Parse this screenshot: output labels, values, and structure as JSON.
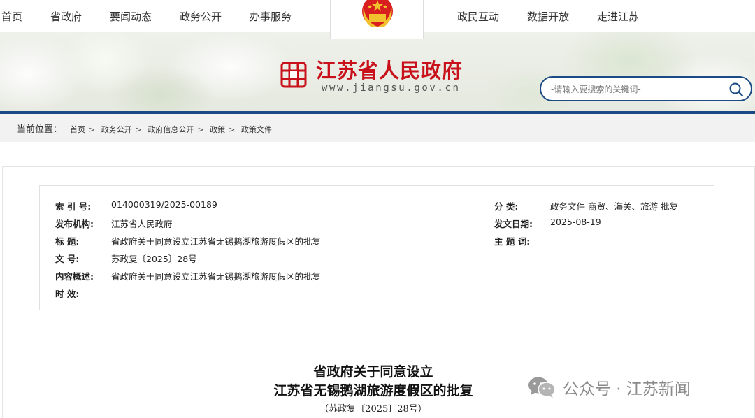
{
  "nav": {
    "left": [
      "首页",
      "省政府",
      "要闻动态",
      "政务公开",
      "办事服务"
    ],
    "right": [
      "政民互动",
      "数据开放",
      "走进江苏"
    ]
  },
  "header": {
    "site_name": "江苏省人民政府",
    "site_url": "www.jiangsu.gov.cn",
    "search_placeholder": "-请输入要搜索的关键词-"
  },
  "breadcrumb": {
    "label": "当前位置：",
    "items": [
      "首页",
      "政务公开",
      "政府信息公开",
      "政策",
      "政策文件"
    ],
    "separator": ">"
  },
  "meta": {
    "index_label": "索 引 号:",
    "index_value": "014000319/2025-00189",
    "issuer_label": "发布机构:",
    "issuer_value": "江苏省人民政府",
    "title_label": "标 题:",
    "title_value": "省政府关于同意设立江苏省无锡鹅湖旅游度假区的批复",
    "docno_label": "文 号:",
    "docno_value": "苏政复〔2025〕28号",
    "summary_label": "内容概述:",
    "summary_value": "省政府关于同意设立江苏省无锡鹅湖旅游度假区的批复",
    "validity_label": "时 效:",
    "validity_value": "",
    "category_label": "分 类:",
    "category_value": "政务文件 商贸、海关、旅游 批复",
    "date_label": "发文日期:",
    "date_value": "2025-08-19",
    "subject_label": "主 题 词:",
    "subject_value": ""
  },
  "document": {
    "title_line1": "省政府关于同意设立",
    "title_line2": "江苏省无锡鹅湖旅游度假区的批复",
    "doc_number": "（苏政复〔2025〕28号）"
  },
  "watermark": {
    "text": "公众号 · 江苏新闻",
    "icon": "wechat-icon"
  },
  "colors": {
    "brand_red": "#c8111a",
    "brand_blue": "#1b4a84",
    "emblem_gold": "#f2c12e"
  }
}
